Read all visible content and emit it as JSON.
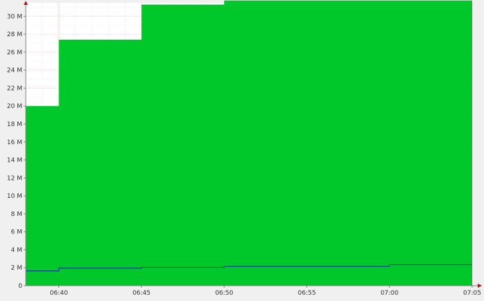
{
  "chart_data": {
    "type": "area",
    "x_ticks": [
      "06:40",
      "06:45",
      "06:50",
      "06:55",
      "07:00",
      "07:05"
    ],
    "y_ticks": [
      "0",
      "2 M",
      "4 M",
      "6 M",
      "8 M",
      "10 M",
      "12 M",
      "14 M",
      "16 M",
      "18 M",
      "20 M",
      "22 M",
      "24 M",
      "26 M",
      "28 M",
      "30 M"
    ],
    "xlim": [
      "06:38",
      "07:05"
    ],
    "ylim": [
      0,
      31.5
    ],
    "grid": true,
    "series": [
      {
        "kind": "area-step",
        "color": "#00c82a",
        "points": [
          {
            "x": "06:38",
            "y": 20.0
          },
          {
            "x": "06:40",
            "y": 27.4
          },
          {
            "x": "06:45",
            "y": 31.3
          },
          {
            "x": "06:50",
            "y": 31.75
          },
          {
            "x": "07:05",
            "y": 31.75
          }
        ]
      },
      {
        "kind": "line-step",
        "color": "#1a3a9a",
        "points": [
          {
            "x": "06:38",
            "y": 1.65
          },
          {
            "x": "06:40",
            "y": 1.95
          },
          {
            "x": "06:45",
            "y": 2.05
          },
          {
            "x": "06:50",
            "y": 2.15
          },
          {
            "x": "07:00",
            "y": 2.35
          },
          {
            "x": "07:05",
            "y": 2.35
          }
        ]
      }
    ]
  }
}
